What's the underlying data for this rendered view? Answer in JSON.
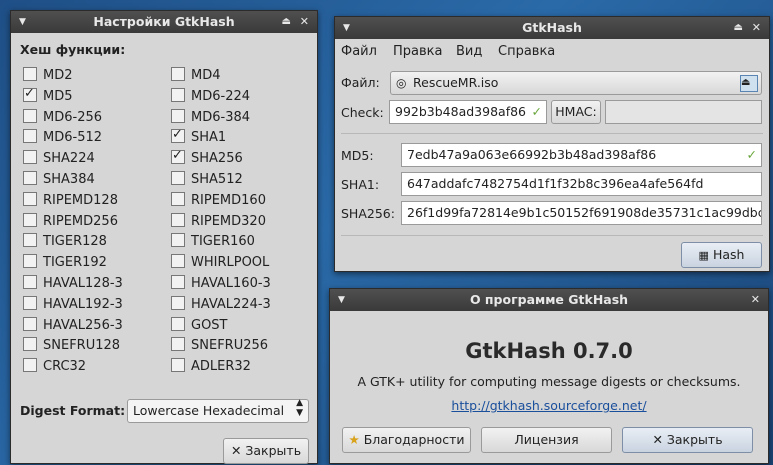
{
  "settings": {
    "title": "Настройки GtkHash",
    "section": "Хеш функции:",
    "col1": [
      {
        "label": "MD2",
        "checked": false
      },
      {
        "label": "MD5",
        "checked": true
      },
      {
        "label": "MD6-256",
        "checked": false
      },
      {
        "label": "MD6-512",
        "checked": false
      },
      {
        "label": "SHA224",
        "checked": false
      },
      {
        "label": "SHA384",
        "checked": false
      },
      {
        "label": "RIPEMD128",
        "checked": false
      },
      {
        "label": "RIPEMD256",
        "checked": false
      },
      {
        "label": "TIGER128",
        "checked": false
      },
      {
        "label": "TIGER192",
        "checked": false
      },
      {
        "label": "HAVAL128-3",
        "checked": false
      },
      {
        "label": "HAVAL192-3",
        "checked": false
      },
      {
        "label": "HAVAL256-3",
        "checked": false
      },
      {
        "label": "SNEFRU128",
        "checked": false
      },
      {
        "label": "CRC32",
        "checked": false
      }
    ],
    "col2": [
      {
        "label": "MD4",
        "checked": false
      },
      {
        "label": "MD6-224",
        "checked": false
      },
      {
        "label": "MD6-384",
        "checked": false
      },
      {
        "label": "SHA1",
        "checked": true
      },
      {
        "label": "SHA256",
        "checked": true
      },
      {
        "label": "SHA512",
        "checked": false
      },
      {
        "label": "RIPEMD160",
        "checked": false
      },
      {
        "label": "RIPEMD320",
        "checked": false
      },
      {
        "label": "TIGER160",
        "checked": false
      },
      {
        "label": "WHIRLPOOL",
        "checked": false
      },
      {
        "label": "HAVAL160-3",
        "checked": false
      },
      {
        "label": "HAVAL224-3",
        "checked": false
      },
      {
        "label": "GOST",
        "checked": false
      },
      {
        "label": "SNEFRU256",
        "checked": false
      },
      {
        "label": "ADLER32",
        "checked": false
      }
    ],
    "digest_label": "Digest Format:",
    "digest_value": "Lowercase Hexadecimal",
    "close": "✕ Закрыть"
  },
  "main": {
    "title": "GtkHash",
    "menu": [
      "Файл",
      "Правка",
      "Вид",
      "Справка"
    ],
    "file_label": "Файл:",
    "file_value": "RescueMR.iso",
    "check_label": "Check:",
    "check_value": "992b3b48ad398af86",
    "hmac_label": "HMAC:",
    "md5_label": "MD5:",
    "md5_value": "7edb47a9a063e66992b3b48ad398af86",
    "sha1_label": "SHA1:",
    "sha1_value": "647addafc7482754d1f1f32b8c396ea4afe564fd",
    "sha256_label": "SHA256:",
    "sha256_value": "26f1d99fa72814e9b1c50152f691908de35731c1ac99dbc",
    "hash_button": "Hash"
  },
  "about": {
    "title": "О программе GtkHash",
    "app_name": "GtkHash 0.7.0",
    "description": "A GTK+ utility for computing message digests or checksums.",
    "url": "http://gtkhash.sourceforge.net/",
    "credits": "Благодарности",
    "license": "Лицензия",
    "close": "✕ Закрыть"
  }
}
